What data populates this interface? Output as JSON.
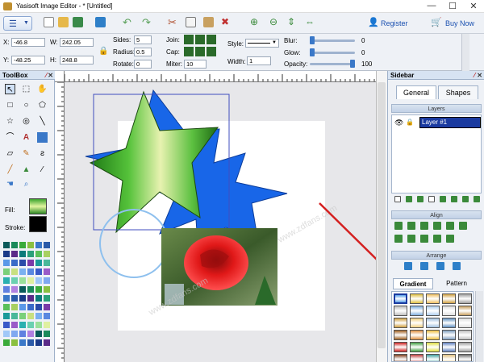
{
  "window": {
    "title": "Yasisoft Image Editor - * [Untitled]",
    "minimize": "—",
    "maximize": "☐",
    "close": "✕"
  },
  "toolbar": {
    "register_label": "Register",
    "buynow_label": "Buy Now"
  },
  "props": {
    "x_label": "X:",
    "x_value": "-46.8",
    "y_label": "Y:",
    "y_value": "-48.25",
    "w_label": "W:",
    "w_value": "242.05",
    "h_label": "H:",
    "h_value": "248.8",
    "sides_label": "Sides:",
    "sides_value": "5",
    "radius_label": "Radius:",
    "radius_value": "0.5",
    "rotate_label": "Rotate:",
    "rotate_value": "0",
    "join_label": "Join:",
    "cap_label": "Cap:",
    "miter_label": "Miter:",
    "miter_value": "10",
    "style_label": "Style:",
    "width_label": "Width:",
    "width_value": "1",
    "blur_label": "Blur:",
    "blur_value": "0",
    "blur_level": 0,
    "glow_label": "Glow:",
    "glow_value": "0",
    "glow_level": 0,
    "opacity_label": "Opacity:",
    "opacity_value": "100",
    "opacity_level": 1.0
  },
  "toolbox": {
    "title": "ToolBox",
    "fill_label": "Fill:",
    "stroke_label": "Stroke:"
  },
  "sidebar": {
    "title": "Sidebar",
    "tabs": [
      "General",
      "Shapes"
    ],
    "layers_title": "Layers",
    "layer_name": "Layer #1",
    "align_title": "Align",
    "arrange_title": "Arrange",
    "bottom_tabs": [
      "Gradient",
      "Pattern"
    ]
  },
  "watermark": "www.zdfans.com",
  "colors": {
    "accent": "#1a5fd0",
    "star_blue": "#1866e8",
    "selection": "#3f4dbf"
  }
}
